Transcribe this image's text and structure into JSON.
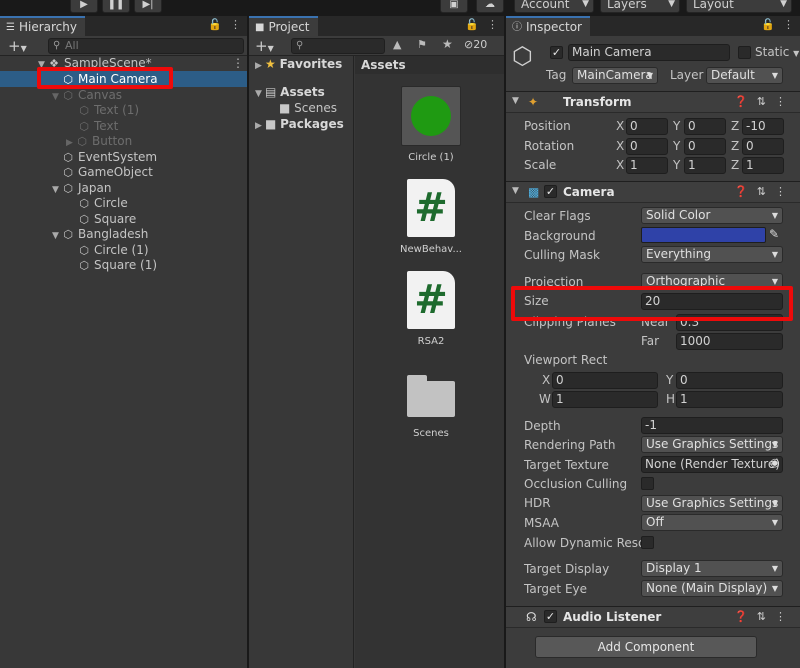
{
  "toolbar": {
    "account_label": "Account",
    "layers_label": "Layers",
    "layout_label": "Layout"
  },
  "hierarchy": {
    "tab_label": "Hierarchy",
    "search_placeholder": "All",
    "items": [
      {
        "label": "SampleScene*"
      },
      {
        "label": "Main Camera"
      },
      {
        "label": "Canvas"
      },
      {
        "label": "Text (1)"
      },
      {
        "label": "Text"
      },
      {
        "label": "Button"
      },
      {
        "label": "EventSystem"
      },
      {
        "label": "GameObject"
      },
      {
        "label": "Japan"
      },
      {
        "label": "Circle"
      },
      {
        "label": "Square"
      },
      {
        "label": "Bangladesh"
      },
      {
        "label": "Circle (1)"
      },
      {
        "label": "Square (1)"
      }
    ]
  },
  "project": {
    "tab_label": "Project",
    "hidden_count": "20",
    "tree": {
      "favorites": "Favorites",
      "assets": "Assets",
      "scenes": "Scenes",
      "packages": "Packages"
    },
    "assets_header": "Assets",
    "assets": [
      {
        "label": "Circle (1)"
      },
      {
        "label": "NewBehav..."
      },
      {
        "label": "RSA2"
      },
      {
        "label": "Scenes"
      }
    ],
    "script_glyph": "#"
  },
  "inspector": {
    "tab_label": "Inspector",
    "object_name": "Main Camera",
    "static_label": "Static",
    "tag_label": "Tag",
    "tag_value": "MainCamera",
    "layer_label": "Layer",
    "layer_value": "Default",
    "transform": {
      "title": "Transform",
      "position_label": "Position",
      "rotation_label": "Rotation",
      "scale_label": "Scale",
      "axis_x": "X",
      "axis_y": "Y",
      "axis_z": "Z",
      "position": {
        "x": "0",
        "y": "0",
        "z": "-10"
      },
      "rotation": {
        "x": "0",
        "y": "0",
        "z": "0"
      },
      "scale": {
        "x": "1",
        "y": "1",
        "z": "1"
      }
    },
    "camera": {
      "title": "Camera",
      "clear_flags_label": "Clear Flags",
      "clear_flags_value": "Solid Color",
      "background_label": "Background",
      "background_color": "#2f42a8",
      "culling_mask_label": "Culling Mask",
      "culling_mask_value": "Everything",
      "projection_label": "Projection",
      "projection_value": "Orthographic",
      "size_label": "Size",
      "size_value": "20",
      "clipping_planes_label": "Clipping Planes",
      "near_label": "Near",
      "near_value": "0.3",
      "far_label": "Far",
      "far_value": "1000",
      "viewport_rect_label": "Viewport Rect",
      "vp_x_label": "X",
      "vp_y_label": "Y",
      "vp_w_label": "W",
      "vp_h_label": "H",
      "vp_x": "0",
      "vp_y": "0",
      "vp_w": "1",
      "vp_h": "1",
      "depth_label": "Depth",
      "depth_value": "-1",
      "rendering_path_label": "Rendering Path",
      "rendering_path_value": "Use Graphics Settings",
      "target_texture_label": "Target Texture",
      "target_texture_value": "None (Render Texture)",
      "occlusion_culling_label": "Occlusion Culling",
      "hdr_label": "HDR",
      "hdr_value": "Use Graphics Settings",
      "msaa_label": "MSAA",
      "msaa_value": "Off",
      "allow_dynamic_label": "Allow Dynamic Resol",
      "target_display_label": "Target Display",
      "target_display_value": "Display 1",
      "target_eye_label": "Target Eye",
      "target_eye_value": "None (Main Display)"
    },
    "audio_listener": {
      "title": "Audio Listener"
    },
    "add_component_label": "Add Component"
  },
  "colors": {
    "selection": "#2c5d87",
    "highlight": "#ee0a0a",
    "circle_asset": "#1f9a12",
    "script_hash": "#1e6b2e"
  }
}
